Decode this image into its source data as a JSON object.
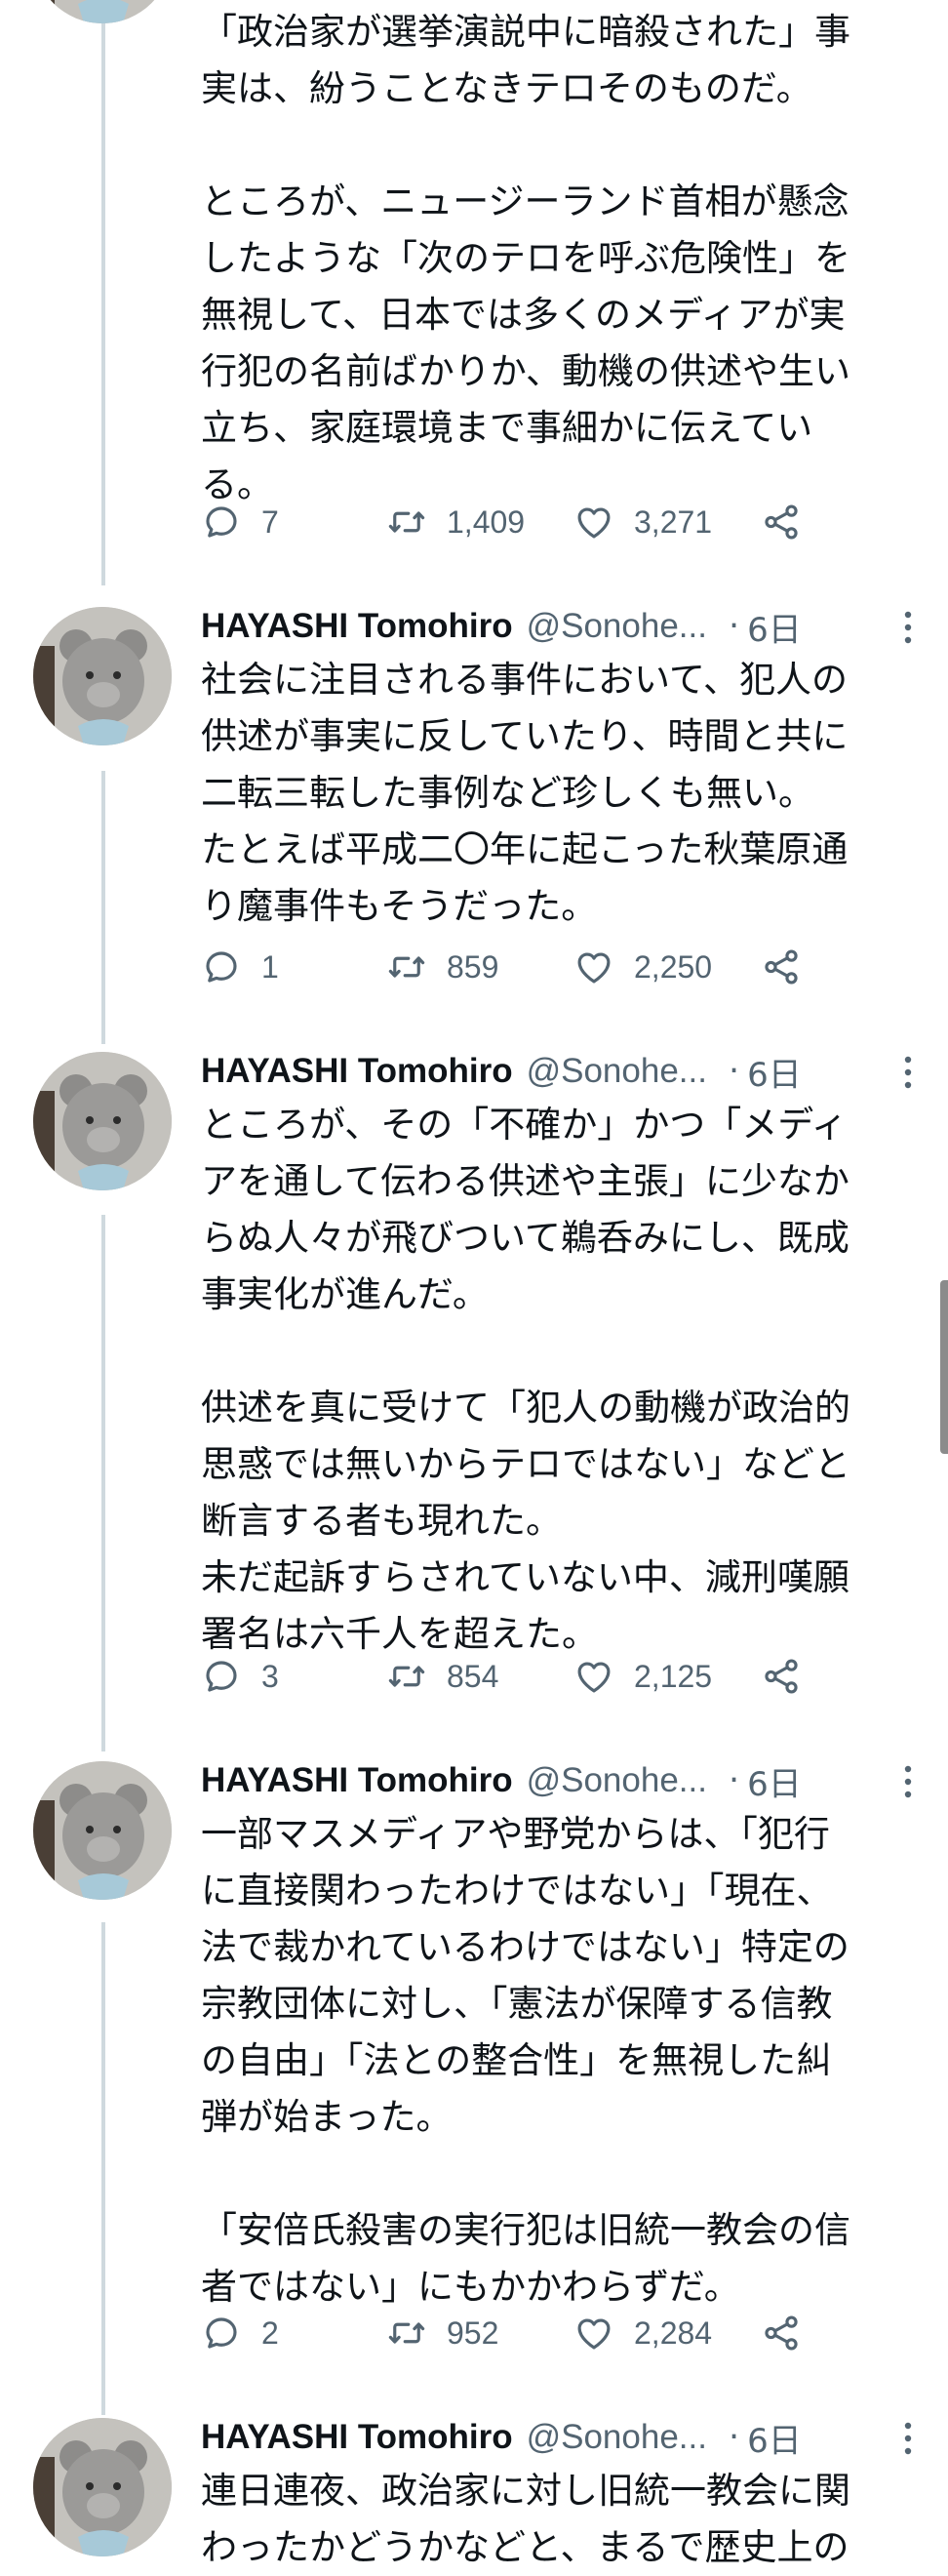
{
  "author": {
    "name": "HAYASHI Tomohiro",
    "handle": "@Sonohe...",
    "separator": "·",
    "avatar_icon": "teddy-bear-avatar-icon"
  },
  "icons": {
    "reply": "reply-icon",
    "retweet": "retweet-icon",
    "like": "like-icon",
    "share": "share-icon",
    "more": "more-options-icon"
  },
  "colors": {
    "text": "#0f1419",
    "secondary": "#536471",
    "thread_line": "#cfd9de"
  },
  "tweets": [
    {
      "timestamp": "",
      "lines": [
        "「政治家が選挙演説中に暗殺された」事",
        "実は、紛うことなきテロそのものだ。",
        "",
        "ところが、ニュージーランド首相が懸念",
        "したような「次のテロを呼ぶ危険性」を",
        "無視して、日本では多くのメディアが実",
        "行犯の名前ばかりか、動機の供述や生い",
        "立ち、家庭環境まで事細かに伝えてい",
        "る。"
      ],
      "replies": "7",
      "retweets": "1,409",
      "likes": "3,271"
    },
    {
      "timestamp": "6日",
      "lines": [
        "社会に注目される事件において、犯人の",
        "供述が事実に反していたり、時間と共に",
        "二転三転した事例など珍しくも無い。",
        "たとえば平成二〇年に起こった秋葉原通",
        "り魔事件もそうだった。"
      ],
      "replies": "1",
      "retweets": "859",
      "likes": "2,250"
    },
    {
      "timestamp": "6日",
      "lines": [
        "ところが、その「不確か」かつ「メディ",
        "アを通して伝わる供述や主張」に少なか",
        "らぬ人々が飛びついて鵜呑みにし、既成",
        "事実化が進んだ。",
        "",
        "供述を真に受けて「犯人の動機が政治的",
        "思惑では無いからテロではない」などと",
        "断言する者も現れた。",
        "未だ起訴すらされていない中、減刑嘆願",
        "署名は六千人を超えた。"
      ],
      "replies": "3",
      "retweets": "854",
      "likes": "2,125"
    },
    {
      "timestamp": "6日",
      "lines": [
        "一部マスメディアや野党からは、「犯行",
        "に直接関わったわけではない」「現在、",
        "法で裁かれているわけではない」特定の",
        "宗教団体に対し、「憲法が保障する信教",
        "の自由」「法との整合性」を無視した糾",
        "弾が始まった。",
        "",
        "「安倍氏殺害の実行犯は旧統一教会の信",
        "者ではない」にもかかわらずだ。"
      ],
      "replies": "2",
      "retweets": "952",
      "likes": "2,284"
    },
    {
      "timestamp": "6日",
      "lines": [
        "連日連夜、政治家に対し旧統一教会に関",
        "わったかどうかなどと、まるで歴史上の"
      ],
      "replies": "",
      "retweets": "",
      "likes": ""
    }
  ]
}
